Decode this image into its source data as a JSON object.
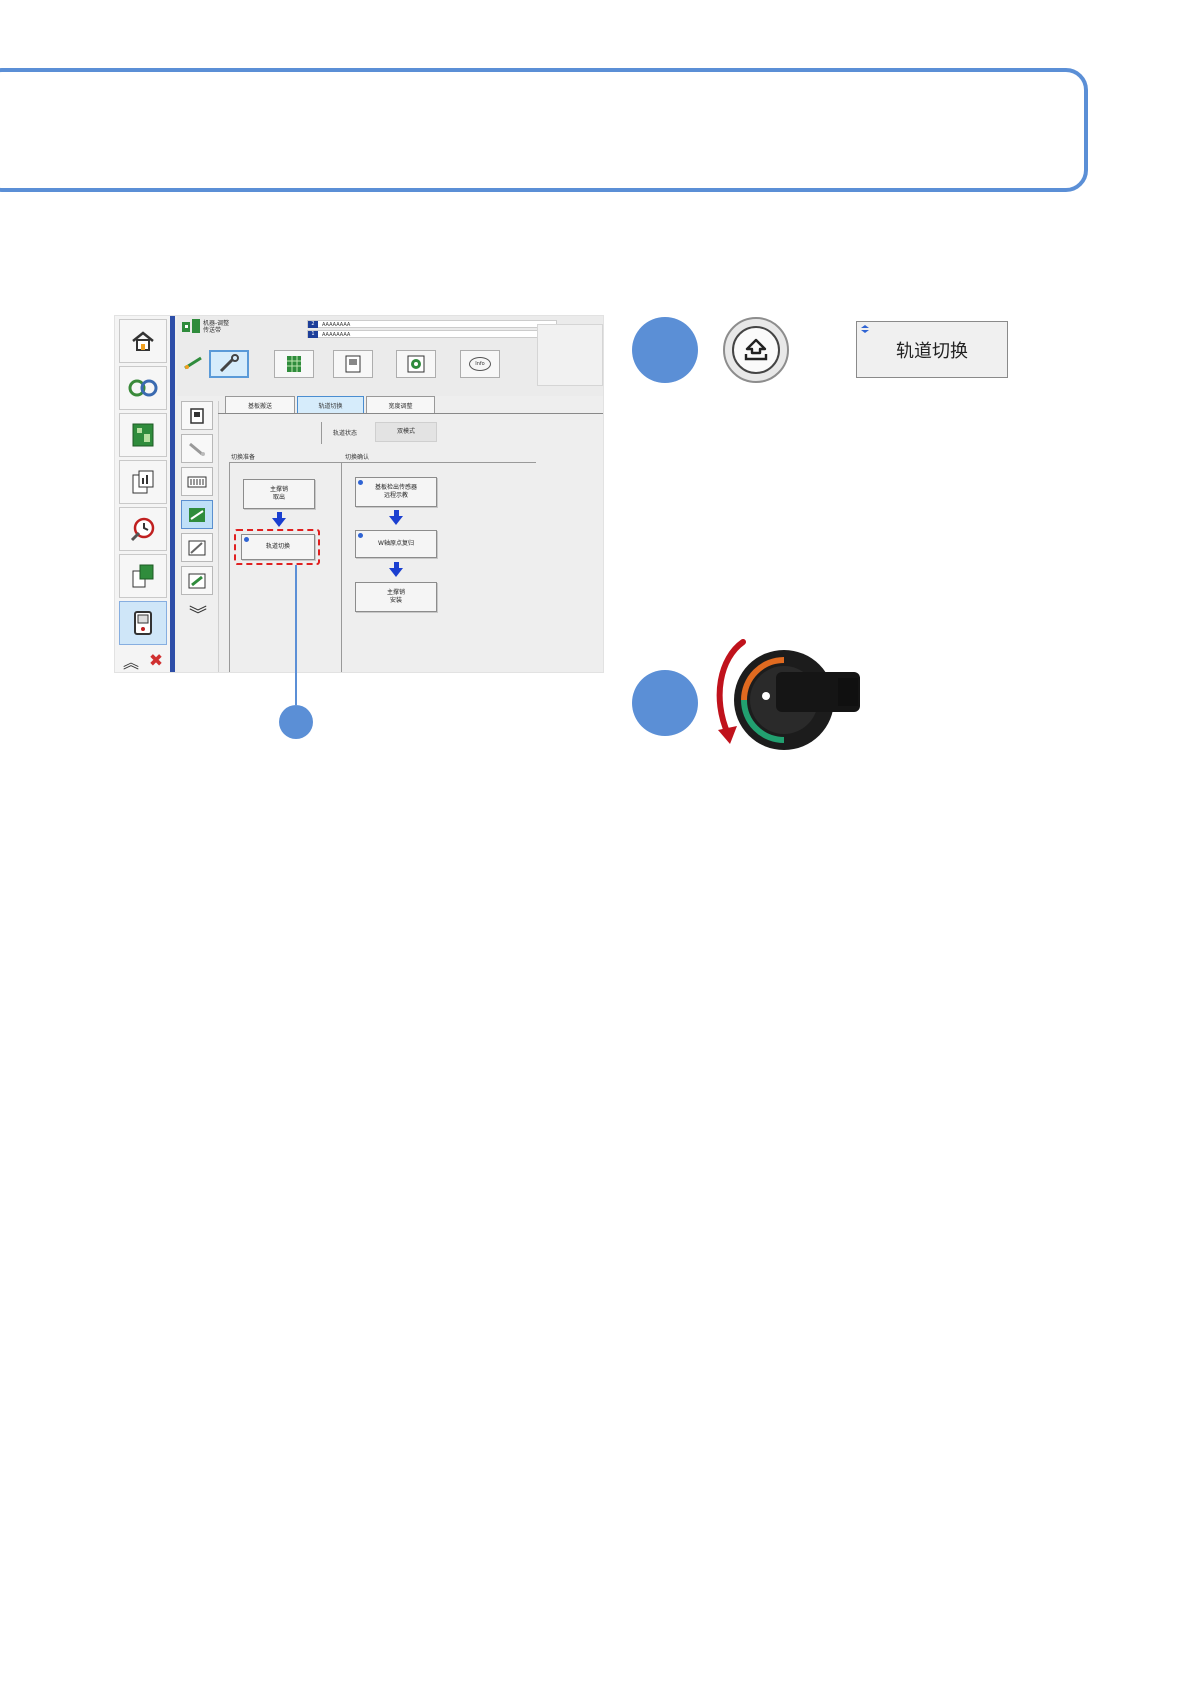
{
  "sidebar": {
    "items": [
      "home-icon",
      "tools-icon",
      "board-icon",
      "report-icon",
      "alarm-icon",
      "production-icon",
      "device-icon"
    ],
    "bottom": [
      "double-up-icon",
      "close-icon"
    ]
  },
  "subbar": {
    "items": [
      "page-icon",
      "nozzle-icon",
      "feeder-icon",
      "conveyor-icon",
      "camera-icon",
      "sheet-icon"
    ],
    "more": "double-down-icon"
  },
  "header": {
    "title_line1": "机器-调整",
    "title_line2": "传送带",
    "id1_num": "2",
    "id1": "AAAAAAAA",
    "id2_num": "1",
    "id2": "AAAAAAAA",
    "toolbar": [
      "link-icon",
      "wrench-icon",
      "grid-icon",
      "form-icon",
      "gear-icon",
      "info-icon"
    ],
    "info_label": "Info"
  },
  "tabs": [
    "基板搬送",
    "轨道切换",
    "宽度调整"
  ],
  "active_tab": "轨道切换",
  "status": {
    "label": "轨道状态",
    "value": "双模式"
  },
  "left_section": {
    "title": "切换准备",
    "steps": [
      "主撑销\n取出",
      "轨道切换"
    ]
  },
  "right_section": {
    "title": "切换确认",
    "steps": [
      "基板检出传感器\n远程示教",
      "W轴原点复归",
      "主撑销\n安装"
    ]
  },
  "callout_button": {
    "label": "轨道切换"
  },
  "colors": {
    "accent": "#5b8fd6",
    "arrow": "#1a3fd0",
    "highlight": "#e02020",
    "rotate_arrow": "#c0121c"
  }
}
